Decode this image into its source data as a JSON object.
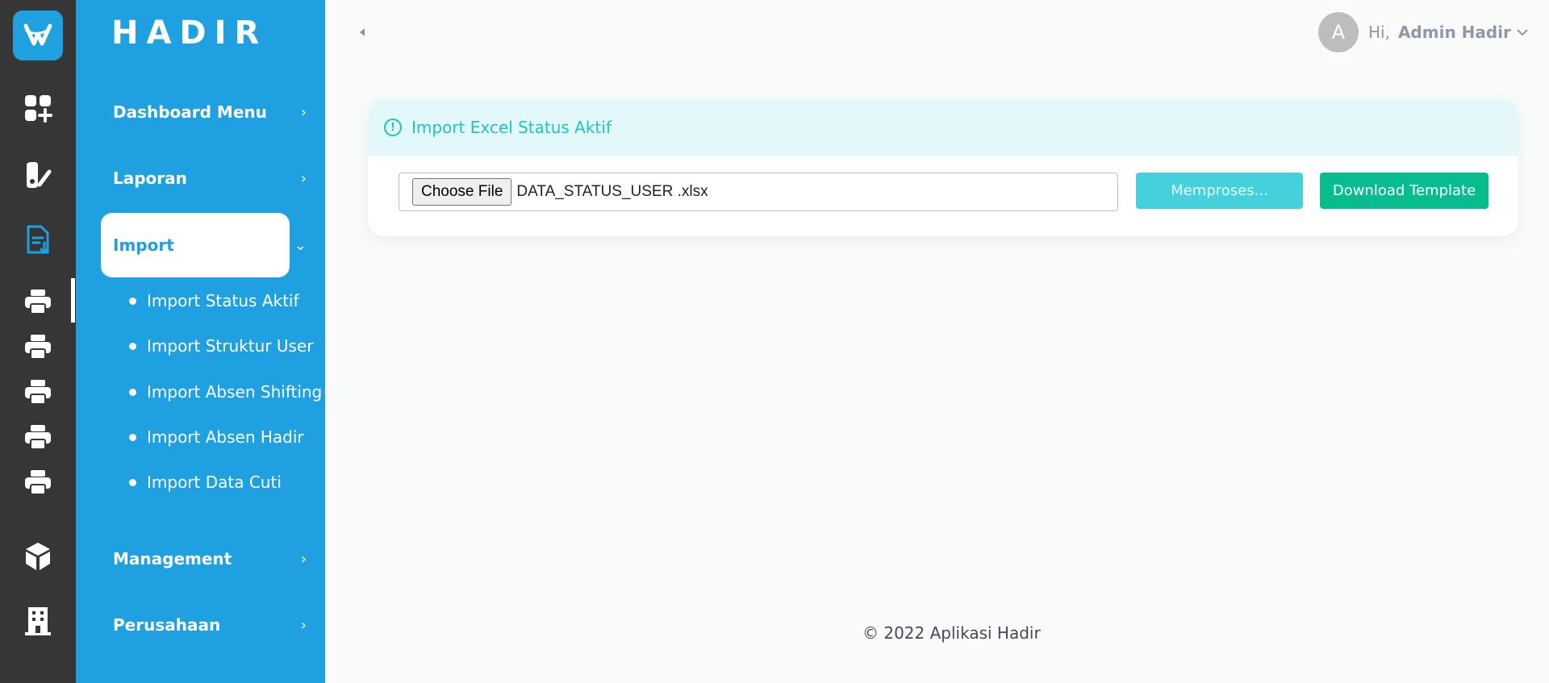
{
  "app": {
    "brand": "HADIR"
  },
  "rail": {
    "icons": [
      "app-logo-icon",
      "dashboard-grid-icon",
      "report-icon",
      "import-document-icon",
      "printer-icon",
      "printer-icon",
      "printer-icon",
      "printer-icon",
      "printer-icon",
      "cube-icon",
      "building-icon"
    ]
  },
  "sidebar": {
    "items": [
      {
        "label": "Dashboard Menu"
      },
      {
        "label": "Laporan"
      },
      {
        "label": "Import"
      },
      {
        "label": "Management"
      },
      {
        "label": "Perusahaan"
      }
    ],
    "import_sub": [
      {
        "label": "Import Status Aktif"
      },
      {
        "label": "Import Struktur User"
      },
      {
        "label": "Import Absen Shifting"
      },
      {
        "label": "Import Absen Hadir"
      },
      {
        "label": "Import Data Cuti"
      }
    ]
  },
  "header": {
    "avatar_letter": "A",
    "greeting": "Hi,",
    "username": "Admin Hadir"
  },
  "card": {
    "title": "Import Excel Status Aktif",
    "choose_label": "Choose File",
    "file_name": "DATA_STATUS_USER .xlsx",
    "process_label": "Memproses...",
    "download_label": "Download Template"
  },
  "footer": {
    "text": "© 2022 Aplikasi Hadir"
  },
  "colors": {
    "rail_bg": "#363636",
    "sidebar_bg": "#1ea0e1",
    "accent_cyan": "#22c0c9",
    "download_green": "#08bd8d"
  }
}
